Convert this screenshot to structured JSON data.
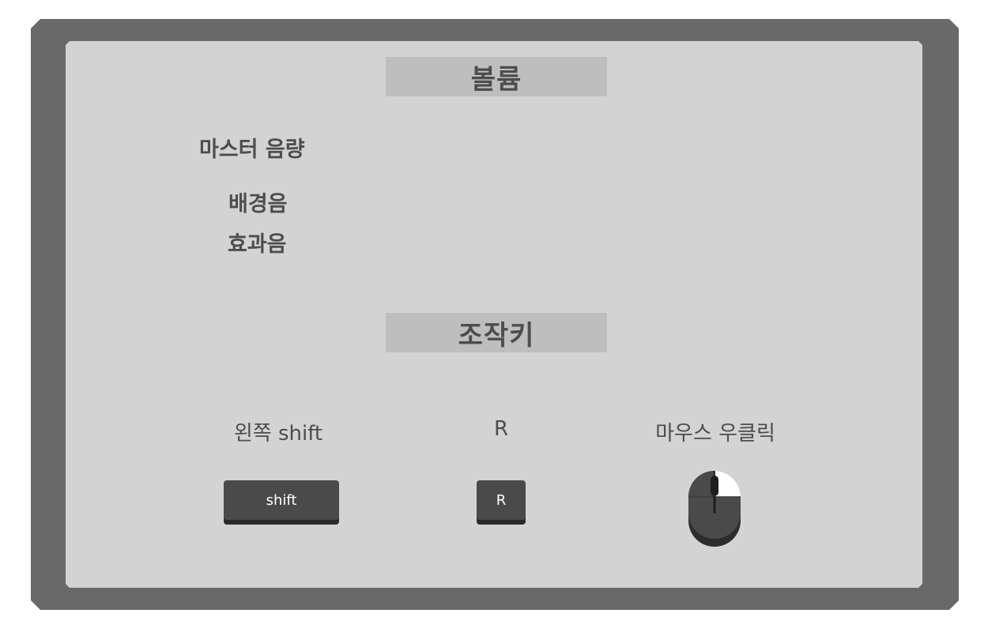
{
  "volume": {
    "header": "볼륨",
    "master_label": "마스터 음량",
    "bgm_label": "배경음",
    "sfx_label": "효과음"
  },
  "controls": {
    "header": "조작키",
    "items": [
      {
        "label": "왼쪽 shift",
        "key_text": "shift"
      },
      {
        "label": "R",
        "key_text": "R"
      },
      {
        "label": "마우스 우클릭",
        "icon": "mouse-right-click-icon"
      }
    ]
  },
  "colors": {
    "frame": "#696969",
    "panel": "#d3d3d3",
    "header_bg": "#bebebe",
    "text": "#4d4d4d",
    "key": "#4a4a4a"
  }
}
